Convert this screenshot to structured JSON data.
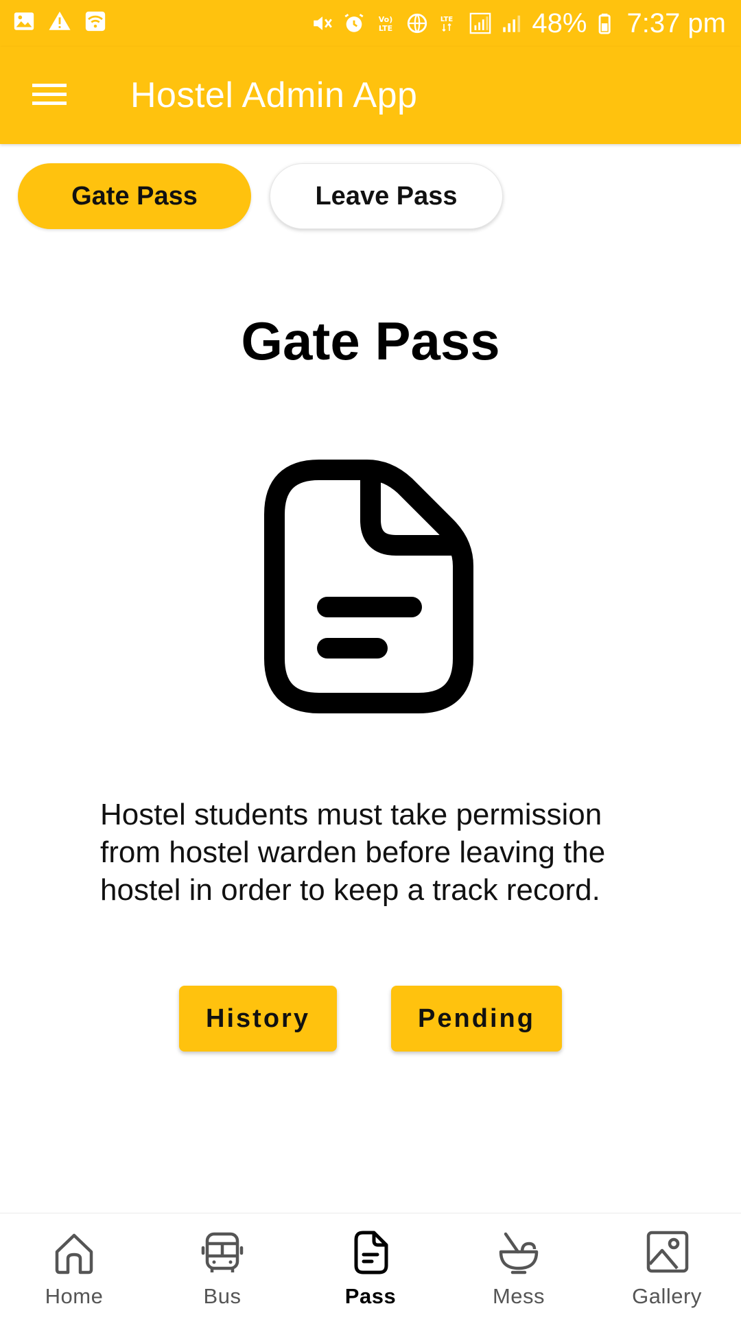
{
  "status_bar": {
    "battery": "48%",
    "time": "7:37 pm",
    "left_icons": [
      "image-notification-icon",
      "warning-icon",
      "wifi-hotspot-icon"
    ],
    "right_icons": [
      "mute-icon",
      "alarm-icon",
      "volte-icon",
      "globe-icon",
      "lte-icon",
      "signal-icon",
      "signal-icon-2",
      "battery-icon"
    ],
    "volte_text": "Vo) LTE",
    "lte_text": "LTE"
  },
  "app_bar": {
    "title": "Hostel Admin App",
    "menu_icon": "hamburger-menu-icon",
    "background": "#FFC20E"
  },
  "tabs": [
    {
      "label": "Gate Pass",
      "selected": true
    },
    {
      "label": "Leave Pass",
      "selected": false
    }
  ],
  "main": {
    "heading": "Gate Pass",
    "illustration": "document-icon",
    "description": "Hostel students must take permission from hostel warden before leaving the hostel in order to keep a track record.",
    "buttons": {
      "history": "History",
      "pending": "Pending"
    }
  },
  "bottom_nav": {
    "items": [
      {
        "label": "Home",
        "icon": "home-icon",
        "active": false
      },
      {
        "label": "Bus",
        "icon": "bus-icon",
        "active": false
      },
      {
        "label": "Pass",
        "icon": "document-icon",
        "active": true
      },
      {
        "label": "Mess",
        "icon": "food-bowl-icon",
        "active": false
      },
      {
        "label": "Gallery",
        "icon": "gallery-icon",
        "active": false
      }
    ]
  },
  "colors": {
    "accent": "#FFC20E",
    "text": "#000000",
    "nav_inactive": "#555555"
  }
}
